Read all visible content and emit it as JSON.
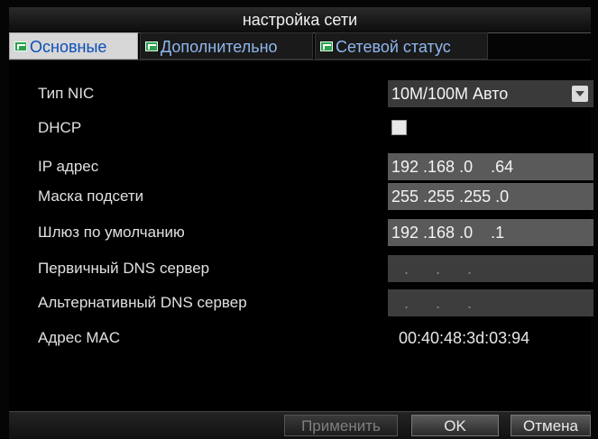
{
  "window": {
    "title": "настройка сети"
  },
  "tabs": [
    {
      "label": "Основные",
      "icon": "tab-icon",
      "active": true
    },
    {
      "label": "Дополнительно",
      "icon": "tab-icon",
      "active": false
    },
    {
      "label": "Сетевой статус",
      "icon": "tab-icon",
      "active": false
    }
  ],
  "form": {
    "nic_type": {
      "label": "Тип NIC",
      "value": "10M/100M Авто"
    },
    "dhcp": {
      "label": "DHCP",
      "checked": false
    },
    "ip": {
      "label": "IP адрес",
      "value": "192 .168 .0    .64"
    },
    "mask": {
      "label": "Маска подсети",
      "value": "255 .255 .255 .0"
    },
    "gateway": {
      "label": "Шлюз по умолчанию",
      "value": "192 .168 .0    .1"
    },
    "dns1": {
      "label": "Первичный DNS сервер",
      "value": "  .    .    ."
    },
    "dns2": {
      "label": "Альтернативный DNS сервер",
      "value": "  .    .    ."
    },
    "mac": {
      "label": "Адрес MAC",
      "value": "00:40:48:3d:03:94"
    }
  },
  "buttons": {
    "apply": "Применить",
    "ok": "OK",
    "cancel": "Отмена"
  },
  "colors": {
    "active_tab_text": "#0a4fb8",
    "inactive_tab_text": "#8fb7ee",
    "field_bg": "#5a5a5a"
  }
}
